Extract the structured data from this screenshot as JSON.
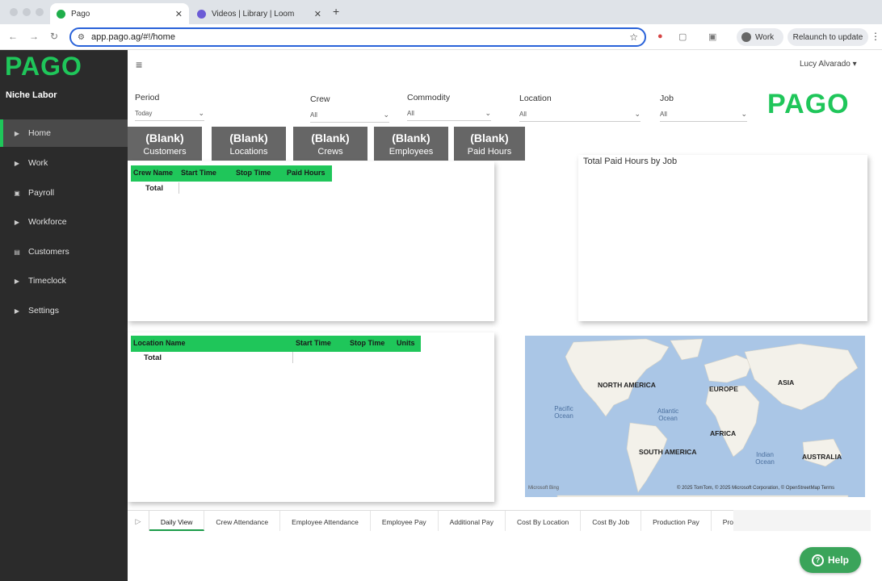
{
  "browser": {
    "tabs": [
      {
        "title": "Pago",
        "active": true
      },
      {
        "title": "Videos | Library | Loom",
        "active": false
      }
    ],
    "url": "app.pago.ag/#!/home",
    "profile": "Work",
    "relaunch": "Relaunch to update"
  },
  "app": {
    "logo": "PAGO",
    "org_name": "Niche Labor",
    "user": "Lucy Alvarado",
    "accent_color": "#1fc65a",
    "sidebar": [
      {
        "label": "Home",
        "icon": "home-icon",
        "active": true
      },
      {
        "label": "Work",
        "icon": "chevron-right-icon",
        "active": false
      },
      {
        "label": "Payroll",
        "icon": "payroll-icon",
        "active": false
      },
      {
        "label": "Workforce",
        "icon": "chevron-right-icon",
        "active": false
      },
      {
        "label": "Customers",
        "icon": "customers-icon",
        "active": false
      },
      {
        "label": "Timeclock",
        "icon": "chevron-right-icon",
        "active": false
      },
      {
        "label": "Settings",
        "icon": "chevron-right-icon",
        "active": false
      }
    ]
  },
  "report": {
    "logo": "PAGO",
    "filters": {
      "period": {
        "label": "Period",
        "value": "Today"
      },
      "crew": {
        "label": "Crew",
        "value": "All"
      },
      "commodity": {
        "label": "Commodity",
        "value": "All"
      },
      "location": {
        "label": "Location",
        "value": "All"
      },
      "job": {
        "label": "Job",
        "value": "All"
      }
    },
    "kpis": [
      {
        "value": "(Blank)",
        "label": "Customers"
      },
      {
        "value": "(Blank)",
        "label": "Locations"
      },
      {
        "value": "(Blank)",
        "label": "Crews"
      },
      {
        "value": "(Blank)",
        "label": "Employees"
      },
      {
        "value": "(Blank)",
        "label": "Paid Hours"
      }
    ],
    "crew_table": {
      "columns": [
        "Crew Name",
        "Start Time",
        "Stop Time",
        "Paid Hours"
      ],
      "total_label": "Total"
    },
    "location_table": {
      "columns": [
        "Location Name",
        "Start Time",
        "Stop Time",
        "Units"
      ],
      "total_label": "Total"
    },
    "chart_title": "Total Paid Hours by Job",
    "map": {
      "continents": [
        "NORTH AMERICA",
        "EUROPE",
        "ASIA",
        "AFRICA",
        "SOUTH AMERICA",
        "AUSTRALIA"
      ],
      "oceans": [
        "Pacific Ocean",
        "Atlantic Ocean",
        "Indian Ocean"
      ],
      "provider": "Microsoft Bing",
      "attribution": "© 2025 TomTom, © 2025 Microsoft Corporation, © OpenStreetMap  Terms"
    },
    "page_tabs": [
      "Daily View",
      "Crew Attendance",
      "Employee Attendance",
      "Employee Pay",
      "Additional Pay",
      "Cost By Location",
      "Cost By Job",
      "Production Pay",
      "Pro"
    ],
    "active_page_tab": "Daily View"
  },
  "help": {
    "label": "Help"
  }
}
